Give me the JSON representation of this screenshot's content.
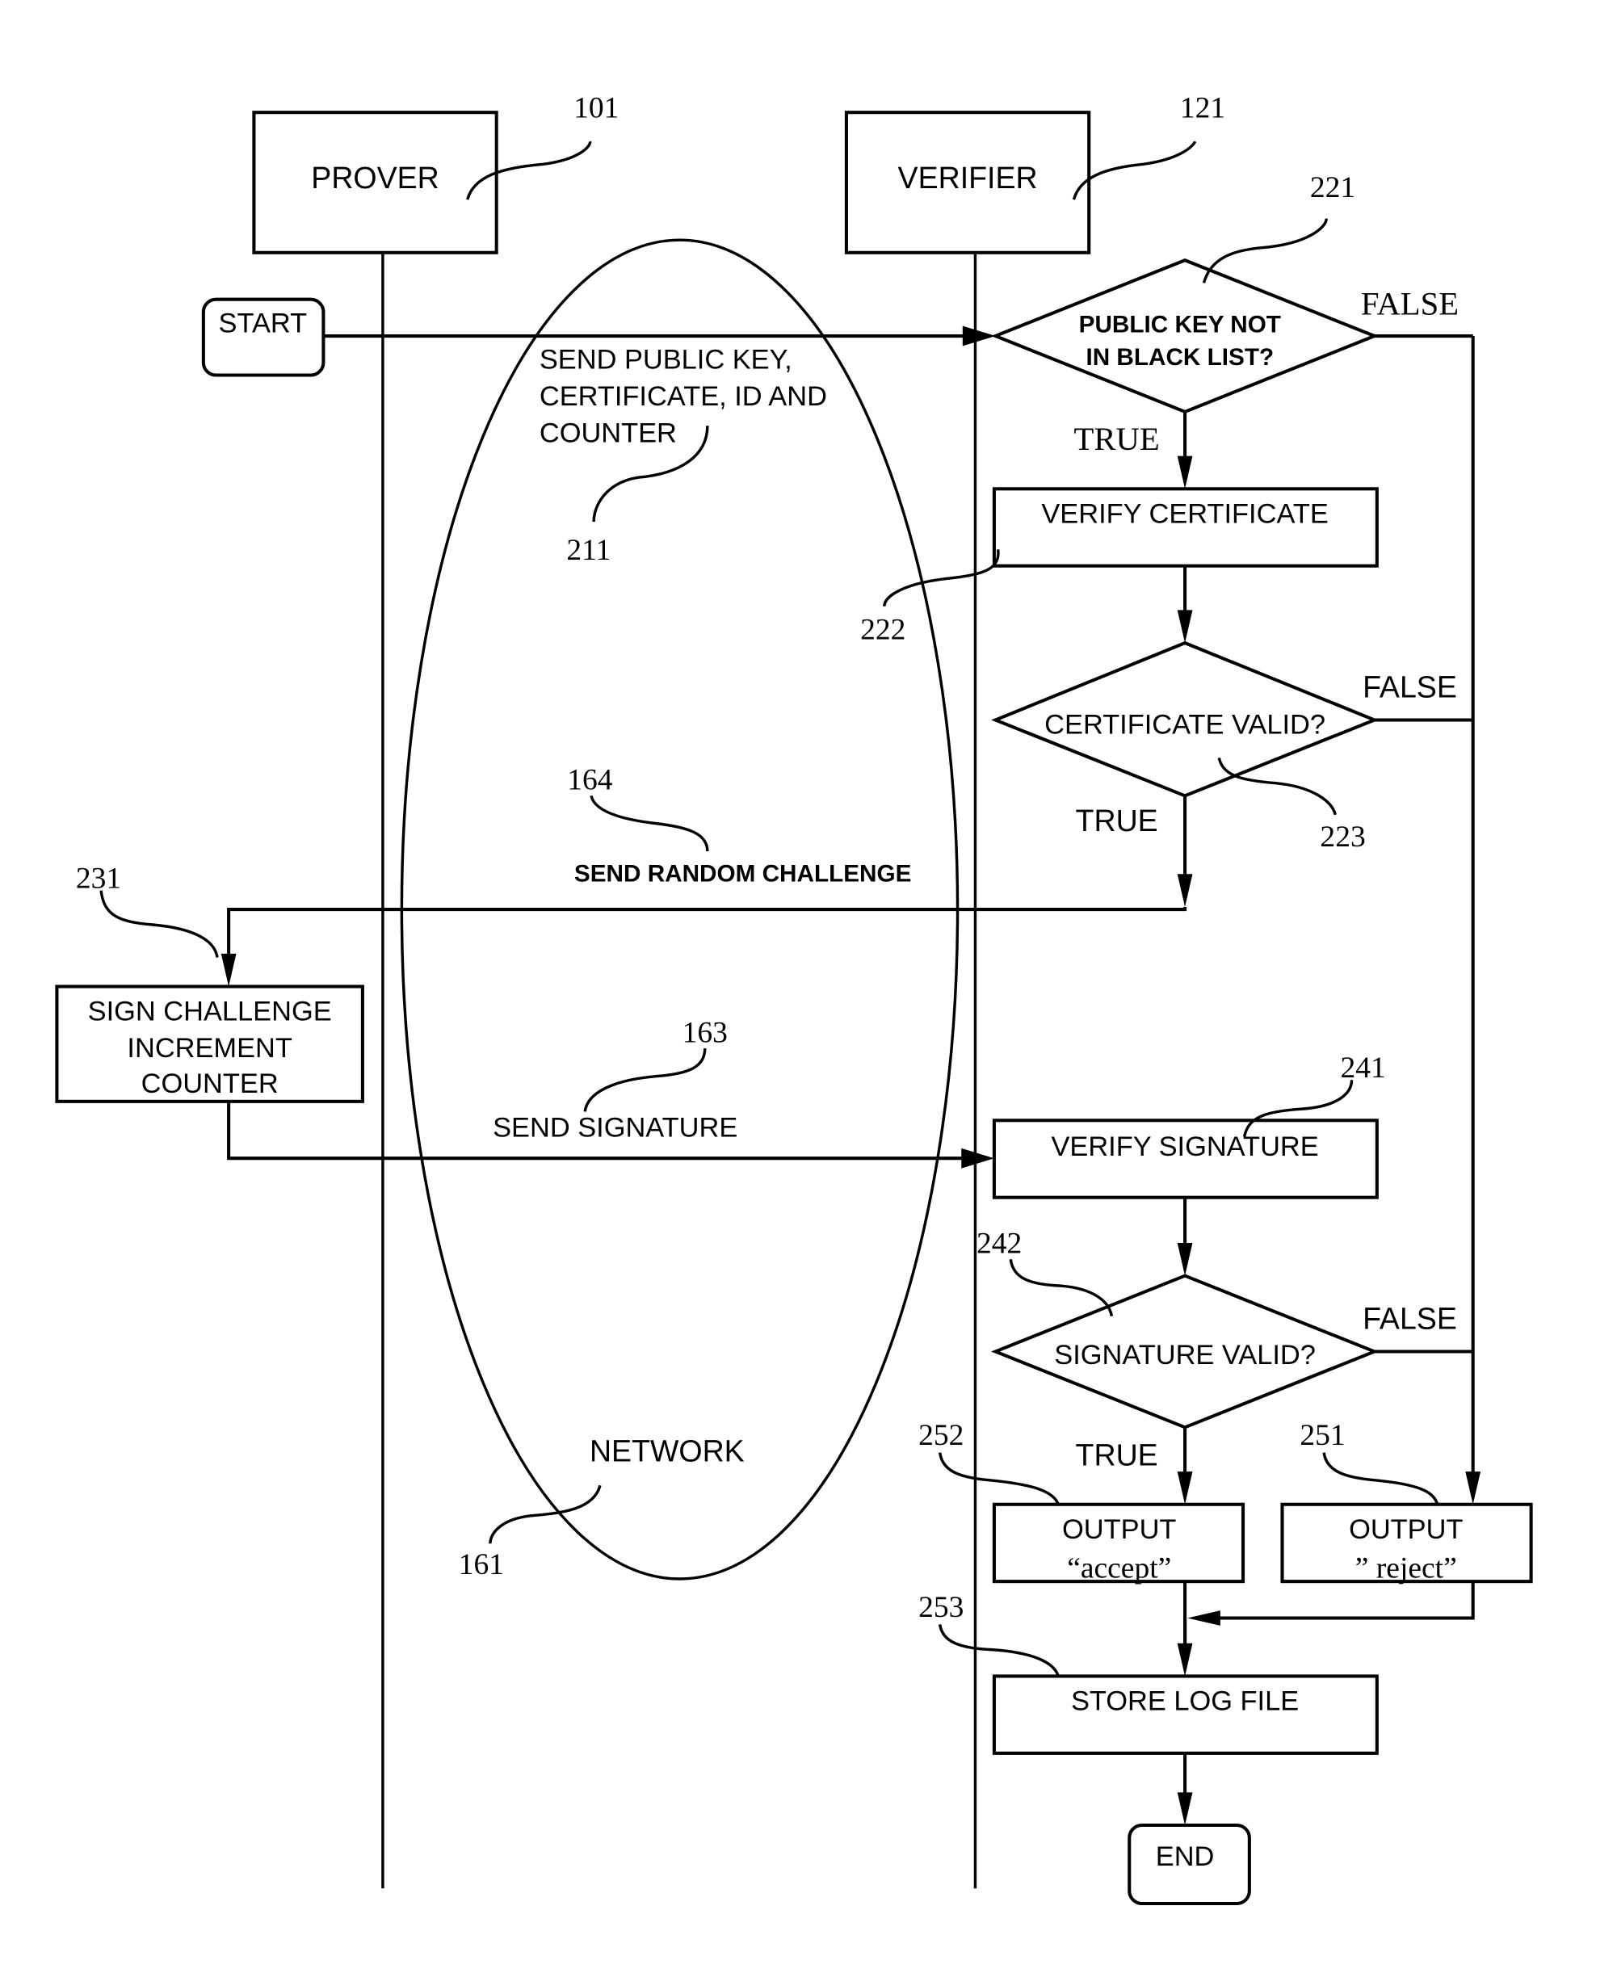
{
  "diagram": {
    "type": "sequence-flowchart",
    "lanes": {
      "prover": {
        "label": "PROVER",
        "ref": "101"
      },
      "verifier": {
        "label": "VERIFIER",
        "ref": "121"
      }
    },
    "network": {
      "label": "NETWORK",
      "ref": "161"
    },
    "terminals": {
      "start": "START",
      "end": "END"
    },
    "messages": {
      "send_public_key": {
        "lines": [
          "SEND PUBLIC KEY,",
          "CERTIFICATE, ID AND",
          "COUNTER"
        ],
        "ref": "211"
      },
      "send_random_challenge": {
        "label": "SEND RANDOM CHALLENGE",
        "ref": "164"
      },
      "send_signature": {
        "label": "SEND SIGNATURE",
        "ref": "163"
      }
    },
    "decisions": {
      "blacklist": {
        "lines": [
          "PUBLIC KEY NOT",
          "IN BLACK LIST?"
        ],
        "ref": "221",
        "true_label": "TRUE",
        "false_label": "FALSE"
      },
      "cert_valid": {
        "label": "CERTIFICATE VALID?",
        "ref": "223",
        "true_label": "TRUE",
        "false_label": "FALSE"
      },
      "sig_valid": {
        "label": "SIGNATURE VALID?",
        "ref": "242",
        "true_label": "TRUE",
        "false_label": "FALSE"
      }
    },
    "processes": {
      "verify_cert": {
        "label": "VERIFY CERTIFICATE",
        "ref": "222"
      },
      "sign_challenge": {
        "lines": [
          "SIGN CHALLENGE",
          "INCREMENT",
          "COUNTER"
        ],
        "ref": "231"
      },
      "verify_sig": {
        "label": "VERIFY SIGNATURE",
        "ref": "241"
      },
      "output_accept": {
        "lines": [
          "OUTPUT",
          "“accept”"
        ],
        "ref": "252"
      },
      "output_reject": {
        "lines": [
          "OUTPUT",
          "” reject”"
        ],
        "ref": "251"
      },
      "store_log": {
        "label": "STORE LOG FILE",
        "ref": "253"
      }
    }
  }
}
